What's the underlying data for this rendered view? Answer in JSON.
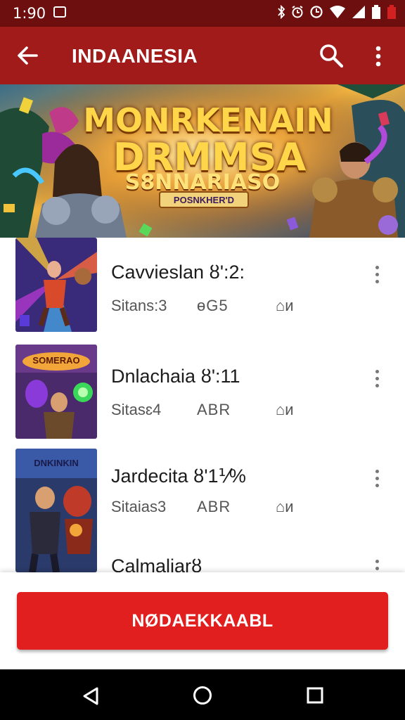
{
  "status_bar": {
    "time": "1:90",
    "icons": [
      "notification-icon",
      "bluetooth-icon",
      "alarm-icon",
      "clock-icon",
      "wifi-icon",
      "signal-icon",
      "battery-icon",
      "battery-low-icon"
    ]
  },
  "app_bar": {
    "title": "INDAANESIA",
    "back_icon": "arrow-back-icon",
    "search_icon": "search-icon",
    "menu_icon": "more-vert-icon"
  },
  "banner": {
    "title_line1": "MONRKENAIN",
    "title_line2": "DRMMSA",
    "subtitle": "S8NNARIASO",
    "badge": "POSNKHER'D"
  },
  "games": [
    {
      "title": "Cavvieslan ȣ':2:",
      "meta1": "Sitans:3",
      "meta2": "ɵG5",
      "meta3": "⌂ᴎ"
    },
    {
      "title": "Dnlachaia ȣ':11",
      "meta1": "Sitasɛ4",
      "meta2": "ABR",
      "meta3": "⌂ᴎ"
    },
    {
      "title": "Jardecita ȣ'1⅟%",
      "meta1": "Sitaias3",
      "meta2": "ABR",
      "meta3": "⌂ᴎ"
    },
    {
      "title": "Calmaliarȣ",
      "meta1": "",
      "meta2": "",
      "meta3": ""
    }
  ],
  "thumb_labels": [
    "",
    "SOMERAO",
    "DNKINKIN"
  ],
  "cta": {
    "label": "NØDAEKKAABL"
  },
  "colors": {
    "status_bar": "#6e0f0f",
    "app_bar": "#a11b1b",
    "cta": "#e11f1f",
    "text_primary": "#1c1c1c",
    "text_secondary": "#555555"
  },
  "nav_bar": {
    "icons": [
      "back-triangle-icon",
      "home-circle-icon",
      "recents-square-icon"
    ]
  }
}
